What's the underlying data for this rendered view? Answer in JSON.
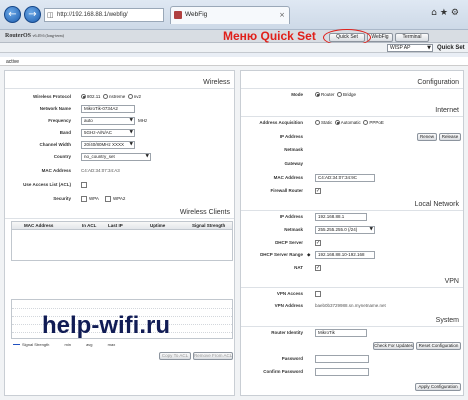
{
  "browser": {
    "url": "http://192.168.88.1/webfig/",
    "tab_title": "WebFig"
  },
  "header": {
    "logo": "RouterOS",
    "version": "v6.49.6 (long-term)",
    "buttons": [
      "Quick Set",
      "WebFig",
      "Terminal"
    ],
    "annotation": "Меню Quick Set"
  },
  "subbar": {
    "mode_select": "WISP AP",
    "title": "Quick Set"
  },
  "status": "active",
  "wireless": {
    "section": "Wireless",
    "protocol_label": "Wireless Protocol",
    "protocol_options": [
      "802.11",
      "nstreme",
      "nv2"
    ],
    "network_name_label": "Network Name",
    "network_name": "MikroTik-0734A2",
    "frequency_label": "Frequency",
    "frequency": "auto",
    "frequency_unit": "MHz",
    "band_label": "Band",
    "band": "5GHz-A/N/AC",
    "channel_width_label": "Channel Width",
    "channel_width": "20/40/80MHz XXXX",
    "country_label": "Country",
    "country": "no_country_set",
    "mac_label": "MAC Address",
    "mac": "C4:AD:34:07:34:A3",
    "acl_label": "Use Access List (ACL)",
    "security_label": "Security",
    "security_options": [
      "WPA",
      "WPA2"
    ]
  },
  "clients": {
    "section": "Wireless Clients",
    "columns": [
      "MAC Address",
      "In ACL",
      "Last IP",
      "Uptime",
      "Signal Strength"
    ],
    "legend": [
      "Signal Strength",
      "min",
      "avg",
      "max"
    ],
    "copy_button": "Copy To ACL",
    "remove_button": "Remove From ACL"
  },
  "watermark": "help-wifi.ru",
  "configuration": {
    "section": "Configuration",
    "mode_label": "Mode",
    "mode_options": [
      "Router",
      "Bridge"
    ]
  },
  "internet": {
    "section": "Internet",
    "acq_label": "Address Acquisition",
    "acq_options": [
      "Static",
      "Automatic",
      "PPPoE"
    ],
    "ip_label": "IP Address",
    "renew_button": "Renew",
    "release_button": "Release",
    "netmask_label": "Netmask",
    "gateway_label": "Gateway",
    "mac_label": "MAC Address",
    "mac": "C4:AD:34:07:34:9C",
    "firewall_label": "Firewall Router"
  },
  "local": {
    "section": "Local Network",
    "ip_label": "IP Address",
    "ip": "192.168.88.1",
    "netmask_label": "Netmask",
    "netmask": "255.255.255.0 (/24)",
    "dhcp_label": "DHCP Server",
    "dhcp_range_label": "DHCP Server Range",
    "dhcp_range": "192.168.88.10-192.168",
    "nat_label": "NAT"
  },
  "vpn": {
    "section": "VPN",
    "access_label": "VPN Access",
    "address_label": "VPN Address",
    "address": "baeb0b3729988.sn.mynetname.net"
  },
  "system": {
    "section": "System",
    "identity_label": "Router Identity",
    "identity": "MikroTik",
    "check_updates_button": "Check For Updates",
    "reset_button": "Reset Configuration",
    "password_label": "Password",
    "confirm_label": "Confirm Password",
    "apply_button": "Apply Configuration"
  }
}
